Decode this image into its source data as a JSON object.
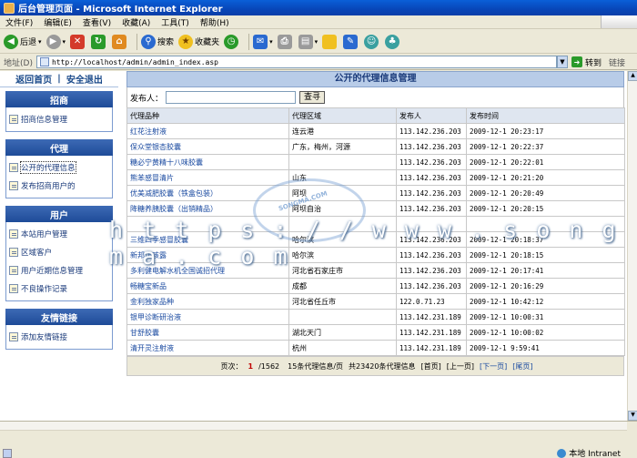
{
  "window": {
    "title": "后台管理页面 - Microsoft Internet Explorer"
  },
  "menu": [
    "文件(F)",
    "编辑(E)",
    "查看(V)",
    "收藏(A)",
    "工具(T)",
    "帮助(H)"
  ],
  "toolbar": {
    "back": "后退",
    "search": "搜索",
    "favorites": "收藏夹"
  },
  "address": {
    "label": "地址(D)",
    "url": "http://localhost/admin/admin_index.asp",
    "go": "转到",
    "links": "链接"
  },
  "topnav": {
    "home": "返回首页",
    "logout": "安全退出"
  },
  "sidebar": [
    {
      "title": "招商",
      "items": [
        {
          "label": "招商信息管理"
        }
      ]
    },
    {
      "title": "代理",
      "items": [
        {
          "label": "公开的代理信息"
        },
        {
          "label": "发布招商用户的"
        }
      ]
    },
    {
      "title": "用户",
      "items": [
        {
          "label": "本站用户管理"
        },
        {
          "label": "区域客户"
        },
        {
          "label": "用户近期信息管理"
        },
        {
          "label": "不良操作记录"
        }
      ]
    },
    {
      "title": "友情链接",
      "items": [
        {
          "label": "添加友情链接"
        }
      ]
    }
  ],
  "main": {
    "title": "公开的代理信息管理",
    "search": {
      "label": "发布人：",
      "button": "查寻"
    },
    "columns": [
      "代理品种",
      "代理区域",
      "发布人",
      "发布时间"
    ],
    "rows": [
      [
        "红花注射液",
        "连云港",
        "113.142.236.203",
        "2009-12-1 20:23:17"
      ],
      [
        "保众堂银杏胶囊",
        "广东，梅州，河源",
        "113.142.236.203",
        "2009-12-1 20:22:37"
      ],
      [
        "糖必宁黄精十八味胶囊",
        "",
        "113.142.236.203",
        "2009-12-1 20:22:01"
      ],
      [
        "熊苯感冒清片",
        "山东",
        "113.142.236.203",
        "2009-12-1 20:21:20"
      ],
      [
        "优美减肥胶囊（铁盒包装）",
        "阿坝",
        "113.142.236.203",
        "2009-12-1 20:20:49"
      ],
      [
        "降糖养胰胶囊（出销精品）",
        "阿坝自治",
        "113.142.236.203",
        "2009-12-1 20:20:15"
      ],
      [
        "",
        "",
        "",
        ""
      ],
      [
        "三维四季感冒胶囊",
        "哈尔滨",
        "113.142.236.203",
        "2009-12-1 20:18:37"
      ],
      [
        "新邦止咳露",
        "哈尔滨",
        "113.142.236.203",
        "2009-12-1 20:18:15"
      ],
      [
        "多利健电解水机全国诚招代理",
        "河北省石家庄市",
        "113.142.236.203",
        "2009-12-1 20:17:41"
      ],
      [
        "畅糖宝新品",
        "成都",
        "113.142.236.203",
        "2009-12-1 20:16:29"
      ],
      [
        "金利独家品种",
        "河北省任丘市",
        "122.0.71.23",
        "2009-12-1 10:42:12"
      ],
      [
        "银甲诊断研治液",
        "",
        "113.142.231.189",
        "2009-12-1 10:00:31"
      ],
      [
        "甘舒胶囊",
        "湖北天门",
        "113.142.231.189",
        "2009-12-1 10:00:02"
      ],
      [
        "清开灵注射液",
        "杭州",
        "113.142.231.189",
        "2009-12-1 9:59:41"
      ]
    ],
    "pager": {
      "prefix": "页次：",
      "current": "1",
      "total": "/1562",
      "per_page": "15条代理信息/页",
      "total_count": "共23420条代理信息",
      "first": "[首页]",
      "prev": "[上一页]",
      "next": "[下一页]",
      "last": "[尾页]"
    }
  },
  "watermark": {
    "url": "h t t p s : / / w w w . s o n g m a . c o m",
    "logo": "SONGMA.COM"
  },
  "status": {
    "zone": "本地 Intranet"
  },
  "colors": {
    "titlebar": "#0846b8",
    "accent": "#1e4b98",
    "link": "#1a4aa0",
    "pager_current": "#c00000"
  }
}
